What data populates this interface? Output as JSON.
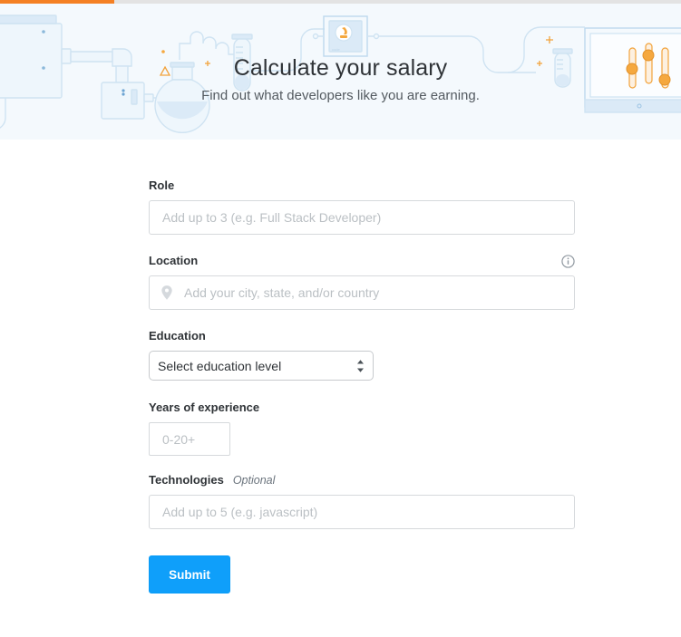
{
  "progress": {
    "percent_label": "17%",
    "fill_color": "#f48024",
    "track_color": "#e3e3e3"
  },
  "hero": {
    "title": "Calculate your salary",
    "subtitle": "Find out what developers like you are earning.",
    "background_color": "#f4f9fd",
    "illustration_line_color": "#cfe3f2",
    "illustration_accent_color": "#f2a33c"
  },
  "form": {
    "fields": [
      {
        "id": "role",
        "label": "Role",
        "placeholder": "Add up to 3 (e.g. Full Stack Developer)",
        "value": "",
        "type": "text"
      },
      {
        "id": "location",
        "label": "Location",
        "placeholder": "Add your city, state, and/or country",
        "value": "",
        "type": "text",
        "leading_icon": "map-pin-icon",
        "trailing_icon": "info-circle-icon"
      },
      {
        "id": "education",
        "label": "Education",
        "selected_option": "Select education level",
        "type": "select"
      },
      {
        "id": "years_of_experience",
        "label": "Years of experience",
        "placeholder": "0-20+",
        "value": "",
        "type": "text"
      },
      {
        "id": "technologies",
        "label": "Technologies",
        "optional_tag": "Optional",
        "placeholder": "Add up to 5 (e.g. javascript)",
        "value": "",
        "type": "text"
      }
    ],
    "submit_label": "Submit",
    "submit_color": "#0f9ffa"
  }
}
